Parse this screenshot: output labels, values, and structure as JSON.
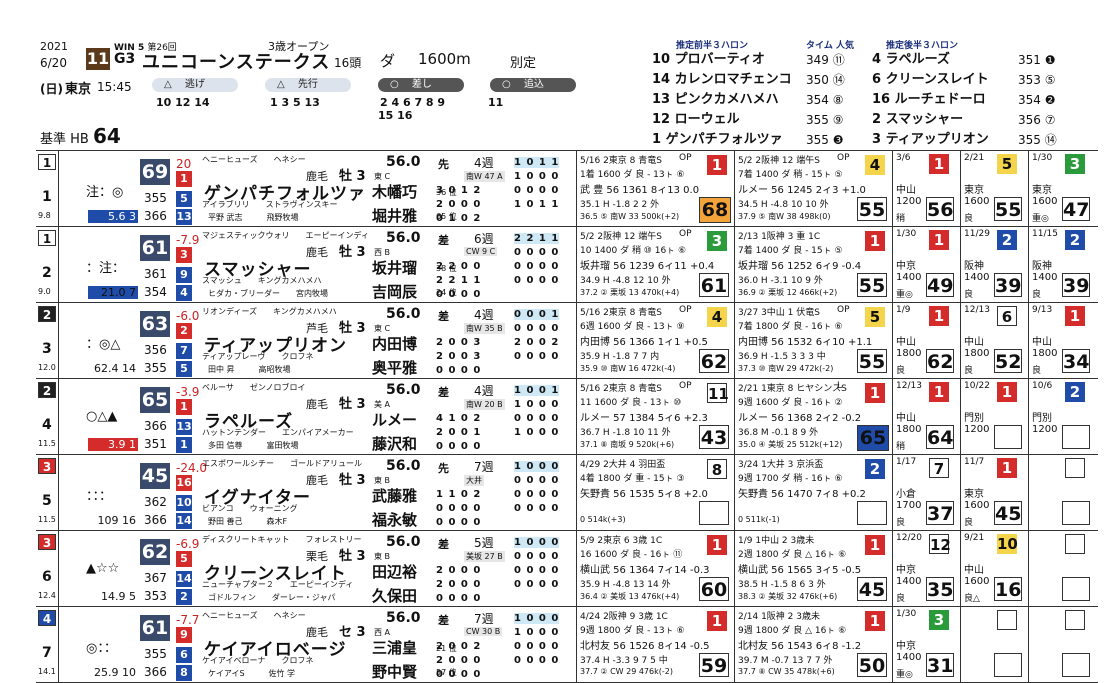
{
  "header": {
    "year": "2021",
    "date": "6/20",
    "race_no": "11",
    "win5": "WIN 5",
    "edition": "第26回",
    "grade": "G3",
    "race_name": "ユニコーンステークス",
    "condition": "3歳オープン",
    "heads": "16頭",
    "surface": "ダ",
    "distance": "1600m",
    "weight_rule": "別定",
    "day": "(日)",
    "course": "東京",
    "post_time": "15:45",
    "style_nige": "逃げ",
    "style_senko": "先行",
    "style_sashi": "差し",
    "style_oikomi": "追込",
    "nige_nums": "10 12 14",
    "senko_nums": "1  3  5  13",
    "sashi_nums": "2  4  6  7  8  9",
    "sashi_nums2": "15 16",
    "oikomi_nums": "11",
    "kijun_label": "基準 HB",
    "kijun_value": "64",
    "pre3_title": "推定前半３ハロン",
    "tl_title": "タイム 人気",
    "post3_title": "推定後半３ハロン",
    "pre3": [
      "10 プロバーティオ",
      "14 カレンロマチェンコ",
      "13 ピンクカメハメハ",
      "12 ローウェル",
      "1 ゲンパチフォルツァ"
    ],
    "pre3_time": [
      "349 ⑪",
      "350 ⑭",
      "354 ⑧",
      "355 ⑨",
      "355 ❸"
    ],
    "post3": [
      "4 ラペルーズ",
      "6 クリーンスレイト",
      "16 ルーチェドーロ",
      "2 スマッシャー",
      "3 ティアップリオン"
    ],
    "post3_time": [
      "351 ❶",
      "353 ⑤",
      "354 ❷",
      "356 ⑦",
      "355 ⑭"
    ]
  },
  "rows": [
    {
      "frame": "1",
      "frame_color": "white",
      "no": "1",
      "odds": "9.8",
      "marks": "注：◎",
      "win_odds": "5.6 3",
      "index": "69",
      "i1": "20",
      "i1b": "1",
      "v1": "355",
      "b1": "5",
      "v2": "366",
      "b2": "13",
      "sire": "ヘニーヒューズ　　ヘネシー",
      "hname": "ゲンパチフォルツァ",
      "coat": "鹿毛",
      "sex": "牡 3",
      "dam": "アイラブリリ　　ストラヴィンスキー",
      "own": "平野 武志　　　飛野牧場",
      "wgt": "56.0",
      "pref": "先",
      "jtag": "東 C",
      "jname": "木幡巧",
      "jn": "36 位",
      "tname": "堀井雅",
      "tn": "65 位",
      "wk": "4週",
      "tr": "南W 47 A",
      "r1": "3 0 1 2",
      "r2": "2 0 0 0",
      "r3": "0 1 0 2",
      "rb1": "1 0 1 1",
      "rb2": "1 0 0 0",
      "rb3": "0 0 0 0",
      "rb4": "1 0 1 1",
      "p1": {
        "d": "5/16 2東京 8 青竜S",
        "cls": "OP",
        "pos": "1",
        "pc": "red",
        "l2": "1着 1600 ダ 良 - 13ㇳ ⑥",
        "l3": "武 豊 56 1361 8ィ13 0.0",
        "l4": "35.1 H -1.8 2 2 外",
        "l5": "36.5 ⑤ 南W 33 500k(+2)",
        "idx": "68",
        "ic": "orange"
      },
      "p2": {
        "d": "5/2 2阪神 12 端午S",
        "cls": "OP",
        "pos": "4",
        "pc": "yellow",
        "l2": "7着 1400 ダ 稍 - 15ㇳ ⑤",
        "l3": "ルメー 56 1245 2ィ3 +1.0",
        "l4": "34.5 H -4.8 10 10 外",
        "l5": "37.9 ⑤ 南W 38 498k(0)",
        "idx": "55",
        "ic": "white"
      },
      "p3": {
        "d": "3/6",
        "cls": "中山 1200",
        "pos": "1",
        "pc": "red",
        "l5": "稍",
        "idx": "56",
        "ic": "white"
      },
      "p4": {
        "d": "2/21",
        "cls": "東京 1600",
        "pos": "5",
        "pc": "yellow",
        "l5": "良",
        "idx": "55",
        "ic": "white"
      },
      "p5": {
        "d": "1/30",
        "cls": "東京 1600",
        "pos": "3",
        "pc": "green",
        "l5": "重◎",
        "idx": "47",
        "ic": "white"
      }
    },
    {
      "frame": "1",
      "frame_color": "white",
      "no": "2",
      "odds": "9.0",
      "marks": "：注：",
      "win_odds": "21.0 7",
      "index": "61",
      "i1": "-7.9",
      "i1b": "3",
      "v1": "361",
      "b1": "9",
      "v2": "354",
      "b2": "4",
      "sire": "マジェスティックウォリ　　エーピーインディ",
      "hname": "スマッシャー",
      "coat": "鹿毛",
      "sex": "牡 3",
      "dam": "スマッシュ　　キングカメハメハ",
      "own": "ヒダカ・ブリーダー　　宮内牧場",
      "wgt": "56.0",
      "pref": "差",
      "jtag": "西 B",
      "jname": "坂井瑠",
      "jn": "38 位",
      "tname": "吉岡辰",
      "tn": "24 位",
      "wk": "6週",
      "tr": "CW 9 C",
      "r1": "2 2 0 0",
      "r2": "2 2 1 1",
      "r3": "0 0 0 0",
      "rb1": "2 2 1 1",
      "rb2": "0 0 0 0",
      "rb3": "0 0 0 0",
      "rb4": "0 0 0 0",
      "p1": {
        "d": "5/2 2阪神 12 端午S",
        "cls": "OP",
        "pos": "3",
        "pc": "green",
        "l2": "10 1400 ダ 稍 ⑩ 16ㇳ ⑥",
        "l3": "坂井瑠 56 1239 6ィ11 +0.4",
        "l4": "34.9 H -4.8 12 10 外",
        "l5": "37.2 ② 栗坂 13 470k(+4)",
        "idx": "61",
        "ic": "white"
      },
      "p2": {
        "d": "2/13 1阪神 3 重 1C",
        "cls": "",
        "pos": "1",
        "pc": "red",
        "l2": "7着 1400 ダ 良 - 15ㇳ ⑤",
        "l3": "坂井瑠 56 1252 6ィ9 -0.4",
        "l4": "36.0 H -3.1 10 9 外",
        "l5": "36.9 ② 栗坂 12 466k(+2)",
        "idx": "55",
        "ic": "white"
      },
      "p3": {
        "d": "1/30",
        "cls": "中京 1400",
        "pos": "1",
        "pc": "red",
        "l5": "重◎",
        "idx": "49",
        "ic": "white"
      },
      "p4": {
        "d": "11/29",
        "cls": "阪神 1400",
        "pos": "2",
        "pc": "blue",
        "l5": "良",
        "idx": "39",
        "ic": "white"
      },
      "p5": {
        "d": "11/15",
        "cls": "阪神 1400",
        "pos": "2",
        "pc": "blue",
        "l5": "良",
        "idx": "39",
        "ic": "white"
      }
    },
    {
      "frame": "2",
      "frame_color": "black",
      "no": "3",
      "odds": "12.0",
      "marks": "：◎△",
      "win_odds": "62.4 14",
      "index": "63",
      "i1": "-6.0",
      "i1b": "2",
      "v1": "356",
      "b1": "7",
      "v2": "355",
      "b2": "5",
      "sire": "リオンディーズ　　キングカメハメハ",
      "hname": "ティアップリオン",
      "coat": "芦毛",
      "sex": "牡 3",
      "dam": "ティアップレーヴ　　クロフネ",
      "own": "田中 昇　　　高昭牧場",
      "wgt": "56.0",
      "pref": "差",
      "jtag": "東 C",
      "jname": "内田博",
      "jn": "",
      "tname": "奥平雅",
      "tn": "",
      "wk": "4週",
      "tr": "南W 35 B",
      "r1": "2 0 0 3",
      "r2": "2 0 0 3",
      "r3": "0 0 0 0",
      "rb1": "0 0 0 1",
      "rb2": "0 0 0 0",
      "rb3": "2 0 0 2",
      "rb4": "0 0 0 0",
      "p1": {
        "d": "5/16 2東京 8 青竜S",
        "cls": "OP",
        "pos": "4",
        "pc": "yellow",
        "l2": "6週 1600 ダ 良 - 13ㇳ ⑨",
        "l3": "内田博 56 1366 1ィ1 +0.5",
        "l4": "35.9 H -1.8 7 7 内",
        "l5": "35.9 ⑩ 南W 16 472k(-4)",
        "idx": "62",
        "ic": "white"
      },
      "p2": {
        "d": "3/27 3中山 1 伏竜S",
        "cls": "OP",
        "pos": "5",
        "pc": "yellow",
        "l2": "7着 1800 ダ 良 - 16ㇳ ⑥",
        "l3": "内田博 56 1532 6ィ10 +1.1",
        "l4": "36.9 H -1.5 3 3 3 中",
        "l5": "37.3 ⑩ 南W 29 472k(-2)",
        "idx": "55",
        "ic": "white"
      },
      "p3": {
        "d": "1/9",
        "cls": "中山 1800",
        "pos": "1",
        "pc": "red",
        "l5": "良",
        "idx": "62",
        "ic": "white"
      },
      "p4": {
        "d": "12/13",
        "cls": "中山 1800",
        "pos": "6",
        "pc": "white",
        "l5": "良",
        "idx": "52",
        "ic": "white"
      },
      "p5": {
        "d": "9/13",
        "cls": "中山 1800",
        "pos": "1",
        "pc": "red",
        "l5": "良",
        "idx": "34",
        "ic": "white"
      }
    },
    {
      "frame": "2",
      "frame_color": "black",
      "no": "4",
      "odds": "11.5",
      "marks": "○△▲",
      "win_odds": "3.9 1",
      "index": "65",
      "i1": "-3.9",
      "i1b": "1",
      "v1": "366",
      "b1": "13",
      "v2": "351",
      "b2": "1",
      "sire": "ベルーサ　　ゼンノロブロイ",
      "hname": "ラペルーズ",
      "coat": "鹿毛",
      "sex": "牡 3",
      "dam": "ハットンテンダー　　エンパイアメーカー",
      "own": "多田 信尊　　　富田牧場",
      "wgt": "56.0",
      "pref": "差",
      "jtag": "美 A",
      "jname": "ルメー",
      "jn": "",
      "tname": "藤沢和",
      "tn": "",
      "wk": "4週",
      "tr": "南W 20 B",
      "r1": "4 1 0 2",
      "r2": "2 0 0 1",
      "r3": "0 0 0 0",
      "rb1": "1 0 0 1",
      "rb2": "1 0 0 0",
      "rb3": "0 0 0 0",
      "rb4": "1 0 0 0",
      "p1": {
        "d": "5/16 2東京 8 青竜S",
        "cls": "OP",
        "pos": "11",
        "pc": "white",
        "l2": "11 1600 ダ 良 - 13ㇳ ⑩",
        "l3": "ルメー 57 1384 5ィ6 +2.3",
        "l4": "36.7 H -1.8 10 11 外",
        "l5": "37.1 ⑧ 南坂 9 520k(+6)",
        "idx": "43",
        "ic": "white"
      },
      "p2": {
        "d": "2/21 1東京 8 ヒヤシンスS",
        "cls": "L",
        "pos": "1",
        "pc": "red",
        "l2": "9週 1600 ダ 良 - 16ㇳ ②",
        "l3": "ルメー 56 1368 2ィ2 -0.2",
        "l4": "36.8 M -0.1 8 9 外",
        "l5": "35.0 ④ 美坂 25 512k(+12)",
        "idx": "65",
        "ic": "blue"
      },
      "p3": {
        "d": "12/13",
        "cls": "中山 1800",
        "pos": "1",
        "pc": "red",
        "l5": "稍",
        "idx": "64",
        "ic": "white"
      },
      "p4": {
        "d": "10/22",
        "cls": "門別 1200",
        "pos": "1",
        "pc": "red",
        "l5": "",
        "idx": "",
        "ic": "white"
      },
      "p5": {
        "d": "10/6",
        "cls": "門別 1200",
        "pos": "2",
        "pc": "blue",
        "l5": "",
        "idx": "",
        "ic": "white"
      }
    },
    {
      "frame": "3",
      "frame_color": "red",
      "no": "5",
      "odds": "11.5",
      "marks": "：：：",
      "win_odds": "109 16",
      "index": "45",
      "i1": "-24.0",
      "i1b": "16",
      "v1": "362",
      "b1": "10",
      "v2": "366",
      "b2": "14",
      "sire": "エスポワールシチー　　ゴールドアリュール",
      "hname": "イグナイター",
      "coat": "鹿毛",
      "sex": "牡 3",
      "dam": "ビアンコ　　ウォーニング",
      "own": "野田 善己　　　森木F",
      "wgt": "56.0",
      "pref": "先",
      "jtag": "東 B",
      "jname": "武藤雅",
      "jn": "",
      "tname": "福永敏",
      "tn": "",
      "wk": "7週",
      "tr": "大井",
      "r1": "1 1 0 2",
      "r2": "0 0 0 0",
      "r3": "0 0 0 0",
      "rb1": "1 0 0 0",
      "rb2": "0 0 0 0",
      "rb3": "0 0 0 0",
      "rb4": "0 0 0 0",
      "p1": {
        "d": "4/29 2大井 4 羽田盃",
        "cls": "",
        "pos": "8",
        "pc": "white",
        "l2": "4着 1800 ダ 重 - 15ㇳ ③",
        "l3": "矢野貴 56 1535 5ィ8 +2.0",
        "l4": "",
        "l5": "0 514k(+3)",
        "idx": "",
        "ic": "white"
      },
      "p2": {
        "d": "3/24 1大井 3 京浜盃",
        "cls": "",
        "pos": "2",
        "pc": "blue",
        "l2": "9週 1700 ダ 稍 - 16ㇳ ⑥",
        "l3": "矢野貴 56 1470 7ィ8 +0.2",
        "l4": "",
        "l5": "0 511k(-1)",
        "idx": "",
        "ic": "white"
      },
      "p3": {
        "d": "1/17",
        "cls": "小倉 1700",
        "pos": "7",
        "pc": "white",
        "l5": "良",
        "idx": "37",
        "ic": "white"
      },
      "p4": {
        "d": "11/7",
        "cls": "東京 1600",
        "pos": "1",
        "pc": "red",
        "l5": "良",
        "idx": "45",
        "ic": "white"
      },
      "p5": {
        "d": "",
        "cls": "",
        "pos": "",
        "pc": "white",
        "l5": "",
        "idx": "",
        "ic": "white"
      }
    },
    {
      "frame": "3",
      "frame_color": "red",
      "no": "6",
      "odds": "12.4",
      "marks": "▲☆☆",
      "win_odds": "14.9 5",
      "index": "62",
      "i1": "-6.9",
      "i1b": "5",
      "v1": "367",
      "b1": "14",
      "v2": "353",
      "b2": "2",
      "sire": "ディスクリートキャット　　フォレストリー",
      "hname": "クリーンスレイト",
      "coat": "栗毛",
      "sex": "牡 3",
      "dam": "ニューチャプター２　　エーピーインディ",
      "own": "ゴドルフィン　　ダーレー・ジャパ",
      "wgt": "56.0",
      "pref": "差",
      "jtag": "東 B",
      "jname": "田辺裕",
      "jn": "",
      "tname": "久保田",
      "tn": "",
      "wk": "5週",
      "tr": "美坂 27 B",
      "r1": "2 0 0 0",
      "r2": "2 0 0 0",
      "r3": "0 0 0 0",
      "rb1": "1 0 0 0",
      "rb2": "0 0 0 0",
      "rb3": "0 0 0 0",
      "rb4": "0 0 0 0",
      "p1": {
        "d": "5/9 2東京 6 3歳 1C",
        "cls": "",
        "pos": "1",
        "pc": "red",
        "l2": "16 1600 ダ 良 - 16ㇳ ⑪",
        "l3": "横山武 56 1364 7ィ14 -0.3",
        "l4": "35.9 H -4.8 13 14 外",
        "l5": "36.4 ② 美坂 13 476k(+4)",
        "idx": "60",
        "ic": "white"
      },
      "p2": {
        "d": "1/9 1中山 2 3歳未",
        "cls": "",
        "pos": "1",
        "pc": "red",
        "l2": "2週 1800 ダ 良 △ 16ㇳ ⑥",
        "l3": "横山武 56 1565 3ィ5 -0.5",
        "l4": "38.5 H -1.5 8 6 3 外",
        "l5": "38.3 ② 美坂 32 476k(+6)",
        "idx": "45",
        "ic": "white"
      },
      "p3": {
        "d": "12/20",
        "cls": "中京 1400",
        "pos": "12",
        "pc": "white",
        "l5": "良",
        "idx": "35",
        "ic": "white"
      },
      "p4": {
        "d": "9/21",
        "cls": "中山 1600",
        "pos": "10",
        "pc": "yellow",
        "l5": "良△",
        "idx": "16",
        "ic": "white"
      },
      "p5": {
        "d": "",
        "cls": "",
        "pos": "",
        "pc": "white",
        "l5": "",
        "idx": "",
        "ic": "white"
      }
    },
    {
      "frame": "4",
      "frame_color": "blue",
      "no": "7",
      "odds": "14.1",
      "marks": "◎：：",
      "win_odds": "25.9 10",
      "index": "61",
      "i1": "-7.7",
      "i1b": "9",
      "v1": "355",
      "b1": "6",
      "v2": "366",
      "b2": "8",
      "sire": "ヘニーヒューズ　　ヘネシー",
      "hname": "ケイアイロベージ",
      "coat": "鹿毛",
      "sex": "セ 3",
      "dam": "ケイアイベローナ　　クロフネ",
      "own": "ケイアイS　　　佐竹 学",
      "wgt": "56.0",
      "pref": "差",
      "jtag": "西 A",
      "jname": "三浦皇",
      "jn": "21 位",
      "tname": "野中賢",
      "tn": "57 位",
      "wk": "7週",
      "tr": "CW 30 B",
      "r1": "2 0 0 2",
      "r2": "2 0 0 0",
      "r3": "0 0 0 0",
      "rb1": "1 0 0 0",
      "rb2": "1 0 0 0",
      "rb3": "0 0 0 0",
      "rb4": "0 0 0 0",
      "p1": {
        "d": "4/24 2阪神 9 3歳 1C",
        "cls": "",
        "pos": "1",
        "pc": "red",
        "l2": "9週 1800 ダ 良 - 13ㇳ ⑥",
        "l3": "北村友 56 1526 8ィ14 -0.5",
        "l4": "37.4 H -3.3 9 7 5 中",
        "l5": "37.7 ② CW 29 476k(-2)",
        "idx": "59",
        "ic": "white"
      },
      "p2": {
        "d": "2/14 1阪神 2 3歳未",
        "cls": "",
        "pos": "1",
        "pc": "red",
        "l2": "9週 1800 ダ 良 △ 16ㇳ ⑥",
        "l3": "北村友 56 1543 6ィ8 -1.2",
        "l4": "39.7 M -0.7 13 7 7 外",
        "l5": "37.7 ⑧ CW 35 478k(+6)",
        "idx": "50",
        "ic": "white"
      },
      "p3": {
        "d": "1/30",
        "cls": "中京 1400",
        "pos": "3",
        "pc": "green",
        "l5": "重◎",
        "idx": "31",
        "ic": "white"
      },
      "p4": {
        "d": "",
        "cls": "",
        "pos": "",
        "pc": "white",
        "l5": "",
        "idx": "",
        "ic": "white"
      },
      "p5": {
        "d": "",
        "cls": "",
        "pos": "",
        "pc": "white",
        "l5": "",
        "idx": "",
        "ic": "white"
      }
    }
  ]
}
